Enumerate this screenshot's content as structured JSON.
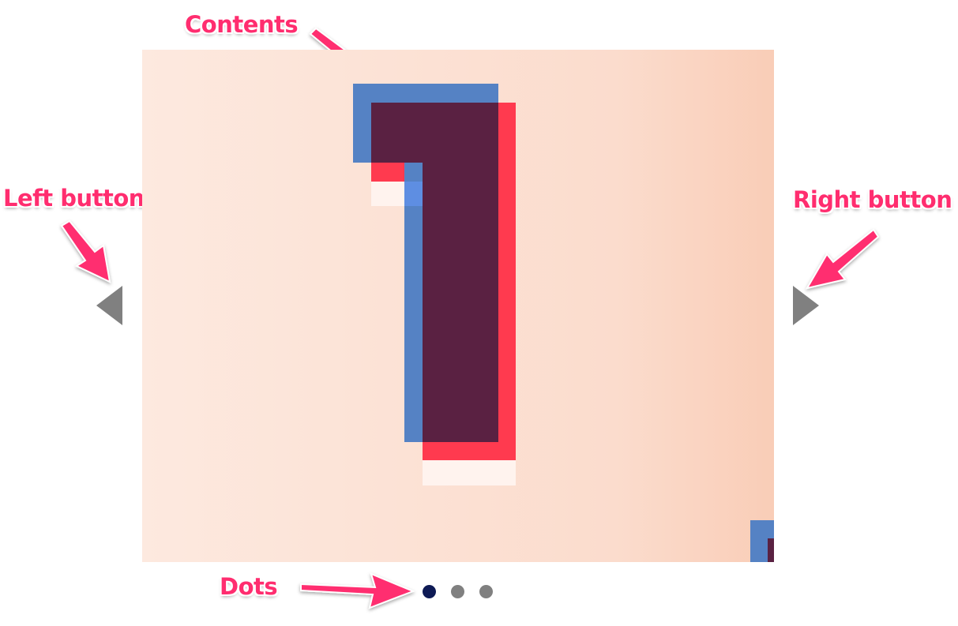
{
  "annotations": {
    "contents": "Contents",
    "left_button": "Left button",
    "right_button": "Right button",
    "dots": "Dots",
    "color": "#ff2d6f"
  },
  "carousel": {
    "slide": {
      "content": "1",
      "background_gradient": [
        "#fde9df",
        "#f9cdb7"
      ],
      "layer_colors": {
        "blue": "#5582c4",
        "red": "#ff3a4f",
        "overlap": "#5a2142"
      }
    },
    "prev_icon": "triangle-left-icon",
    "next_icon": "triangle-right-icon",
    "dots": {
      "count": 3,
      "active_index": 0,
      "active_color": "#0e1a55",
      "inactive_color": "#808080"
    }
  }
}
